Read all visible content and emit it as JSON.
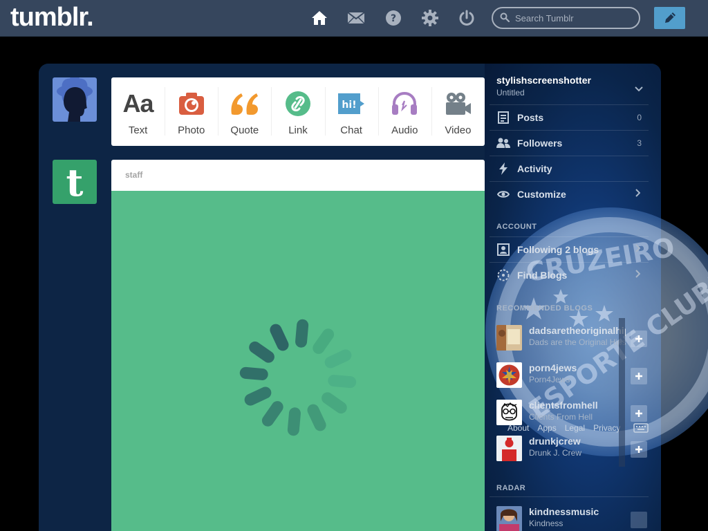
{
  "app": {
    "logo": "tumblr.",
    "search_placeholder": "Search Tumblr"
  },
  "nav": {
    "icons": [
      "home-icon",
      "mail-icon",
      "help-icon",
      "settings-icon",
      "power-icon"
    ],
    "compose_icon": "pencil-icon"
  },
  "post_types": [
    {
      "label": "Text",
      "icon": "text-icon",
      "color": "#444444",
      "glyph": "Aa"
    },
    {
      "label": "Photo",
      "icon": "camera-icon",
      "color": "#d95e40"
    },
    {
      "label": "Quote",
      "icon": "quote-icon",
      "color": "#f2992e"
    },
    {
      "label": "Link",
      "icon": "link-icon",
      "color": "#56bc8a"
    },
    {
      "label": "Chat",
      "icon": "chat-icon",
      "color": "#529ecc",
      "glyph": "hi!"
    },
    {
      "label": "Audio",
      "icon": "headphones-icon",
      "color": "#a77dc2"
    },
    {
      "label": "Video",
      "icon": "video-camera-icon",
      "color": "#748089"
    }
  ],
  "post": {
    "author": "staff",
    "media_color": "#56bc8a",
    "loading_icon": "spinner-icon"
  },
  "sidebar": {
    "blog_name": "stylishscreenshotter",
    "blog_title": "Untitled",
    "menu": [
      {
        "label": "Posts",
        "icon": "posts-icon",
        "count": "0"
      },
      {
        "label": "Followers",
        "icon": "followers-icon",
        "count": "3"
      },
      {
        "label": "Activity",
        "icon": "lightning-icon"
      },
      {
        "label": "Customize",
        "icon": "eye-icon",
        "chevron": true
      }
    ],
    "account_title": "ACCOUNT",
    "account": [
      {
        "label": "Following 2 blogs",
        "icon": "following-icon"
      },
      {
        "label": "Find Blogs",
        "icon": "compass-icon"
      }
    ],
    "recommended_title": "RECOMMENDED BLOGS",
    "recommended": [
      {
        "name": "dadsaretheoriginalhipster",
        "sub": "Dads are the Original Hipster"
      },
      {
        "name": "porn4jews",
        "sub": "Porn4Jews"
      },
      {
        "name": "clientsfromhell",
        "sub": "Clients From Hell"
      },
      {
        "name": "drunkjcrew",
        "sub": "Drunk J. Crew"
      }
    ],
    "footer_links": [
      "About",
      "Apps",
      "Legal",
      "Privacy"
    ],
    "radar_title": "RADAR",
    "radar": {
      "name": "kindnessmusic",
      "sub": "Kindness"
    }
  },
  "colors": {
    "header": "#36465d",
    "compose": "#529ecc",
    "background": "#0a2040"
  }
}
